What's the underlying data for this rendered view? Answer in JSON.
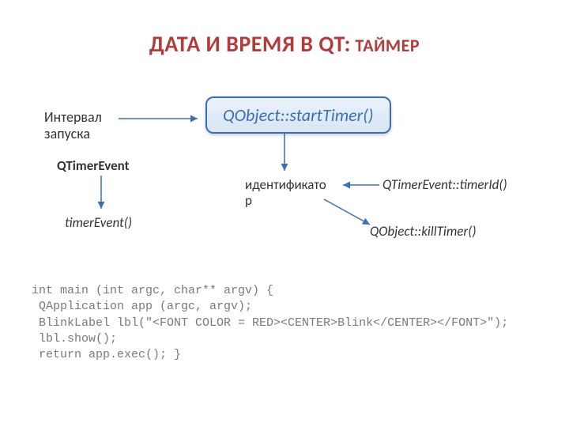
{
  "title_main": "ДАТА И ВРЕМЯ В QT:",
  "title_sub": " ТАЙМЕР",
  "labels": {
    "interval": "Интервал\nзапуска",
    "qtimerevent": "QTimerEvent",
    "timerevent_fn": "timerEvent()",
    "identifier": "идентификато\nр",
    "timerid_fn": "QTimerEvent::timerId()",
    "killtimer_fn": "QObject::killTimer()",
    "starttimer_fn": "QObject::startTimer()"
  },
  "code": "int main (int argc, char** argv) {\n QApplication app (argc, argv);\n BlinkLabel lbl(\"<FONT COLOR = RED><CENTER>Blink</CENTER></FONT>\");\n lbl.show();\n return app.exec(); }"
}
